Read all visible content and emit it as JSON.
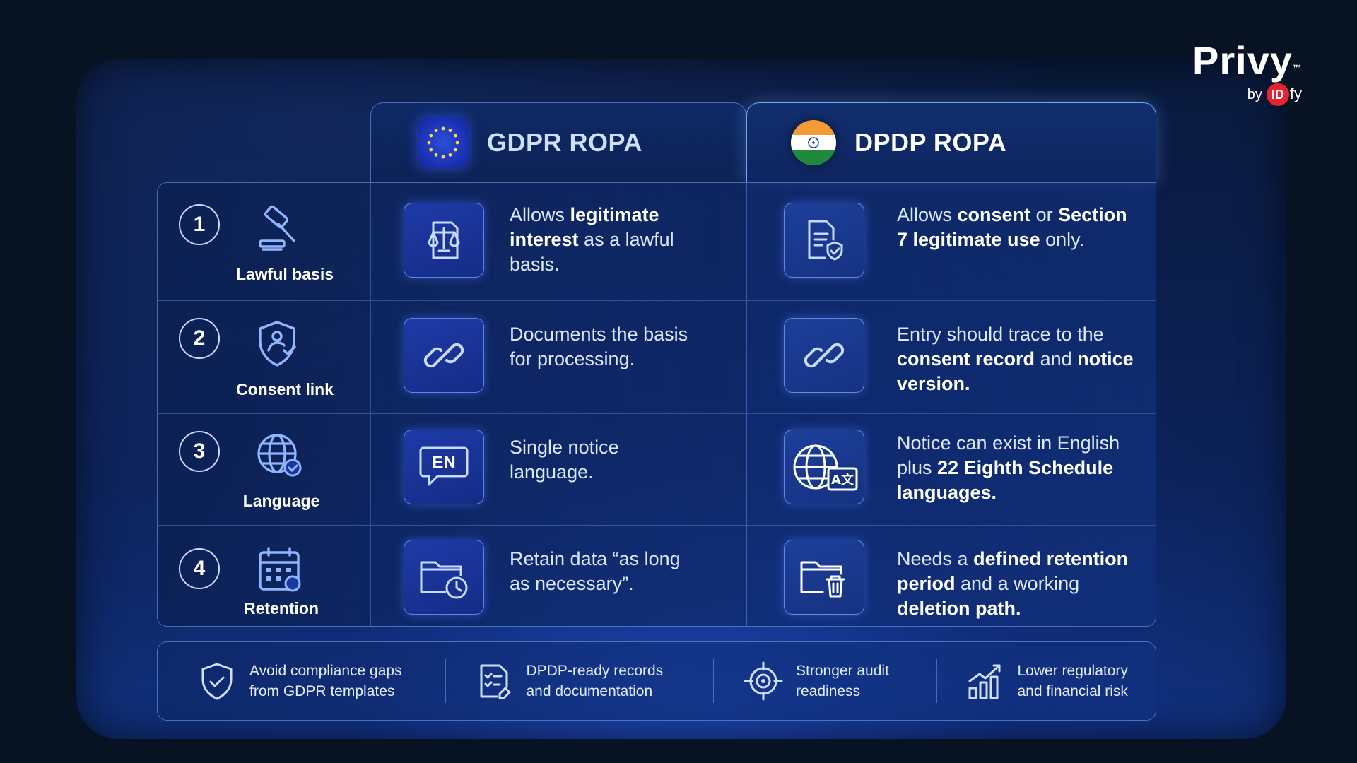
{
  "brand": {
    "name": "Privy",
    "tm": "™",
    "by": "by",
    "company_mark": "ID",
    "company_suffix": "fy"
  },
  "columns": {
    "gdpr": "GDPR ROPA",
    "dpdp": "DPDP ROPA"
  },
  "rows": [
    {
      "number": "1",
      "label": "Lawful basis",
      "label_icon": "gavel-icon",
      "gdpr_icon": "scales-document-icon",
      "dpdp_icon": "document-shield-icon",
      "gdpr": {
        "t1": "Allows ",
        "b1": "legitimate interest",
        "t2": " as a lawful basis.",
        "b2": "",
        "t3": "",
        "b3": "",
        "t4": ""
      },
      "dpdp": {
        "t1": "Allows ",
        "b1": "consent",
        "t2": " or ",
        "b2": "Section 7 legitimate use",
        "t3": " only.",
        "b3": "",
        "t4": ""
      }
    },
    {
      "number": "2",
      "label": "Consent link",
      "label_icon": "shield-user-icon",
      "gdpr_icon": "link-icon",
      "dpdp_icon": "link-icon",
      "gdpr": {
        "t1": "Documents the basis for processing.",
        "b1": "",
        "t2": "",
        "b2": "",
        "t3": "",
        "b3": "",
        "t4": ""
      },
      "dpdp": {
        "t1": "Entry should trace to the ",
        "b1": "consent record",
        "t2": " and ",
        "b2": "notice version.",
        "t3": "",
        "b3": "",
        "t4": ""
      }
    },
    {
      "number": "3",
      "label": "Language",
      "label_icon": "globe-check-icon",
      "gdpr_icon": "speech-bubble-en-icon",
      "dpdp_icon": "globe-translate-icon",
      "gdpr": {
        "t1": "Single notice language.",
        "b1": "",
        "t2": "",
        "b2": "",
        "t3": "",
        "b3": "",
        "t4": ""
      },
      "dpdp": {
        "t1": "Notice can exist in English plus ",
        "b1": "22 Eighth Schedule languages.",
        "t2": "",
        "b2": "",
        "t3": "",
        "b3": "",
        "t4": ""
      }
    },
    {
      "number": "4",
      "label": "Retention",
      "label_icon": "calendar-icon",
      "gdpr_icon": "folder-clock-icon",
      "dpdp_icon": "folder-trash-icon",
      "gdpr": {
        "t1": "Retain data “as long as necessary”.",
        "b1": "",
        "t2": "",
        "b2": "",
        "t3": "",
        "b3": "",
        "t4": ""
      },
      "dpdp": {
        "t1": "Needs a ",
        "b1": "defined retention period",
        "t2": " and a working ",
        "b2": "deletion path.",
        "t3": "",
        "b3": "",
        "t4": ""
      }
    }
  ],
  "icon_text": {
    "en": "EN",
    "translate": "A文"
  },
  "benefits": [
    {
      "icon": "shield-check-icon",
      "line1": "Avoid compliance gaps",
      "line2": "from GDPR templates"
    },
    {
      "icon": "checklist-document-icon",
      "line1": "DPDP-ready records",
      "line2": "and documentation"
    },
    {
      "icon": "target-icon",
      "line1": "Stronger audit",
      "line2": "readiness"
    },
    {
      "icon": "growth-chart-icon",
      "line1": "Lower regulatory",
      "line2": "and financial risk"
    }
  ],
  "colors": {
    "accent": "#6ea6ff",
    "background": "#071322",
    "panel": "#0c2258",
    "india_saffron": "#f39c33",
    "india_green": "#1f8a3b",
    "eu_blue": "#1a2fb0"
  }
}
